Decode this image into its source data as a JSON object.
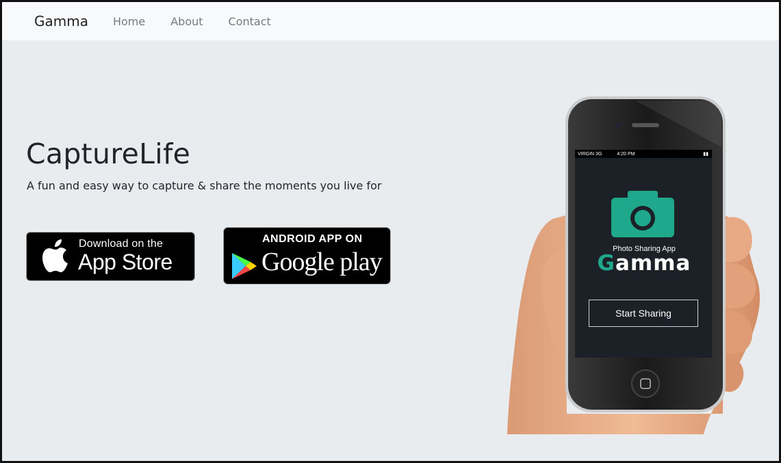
{
  "navbar": {
    "brand": "Gamma",
    "links": [
      "Home",
      "About",
      "Contact"
    ]
  },
  "hero": {
    "title": "CaptureLife",
    "subtitle": "A fun and easy way to capture & share the moments you live for"
  },
  "badges": {
    "appstore": {
      "small": "Download on the",
      "big": "App Store"
    },
    "googleplay": {
      "top": "ANDROID APP ON",
      "big": "Google play"
    }
  },
  "phone": {
    "status": {
      "carrier": "VIRGIN  3G",
      "time": "4:20 PM"
    },
    "tagline": "Photo Sharing App",
    "app_name_first": "G",
    "app_name_rest": "amma",
    "button": "Start Sharing"
  },
  "colors": {
    "accent": "#1fa88c",
    "page_bg": "#e9ecef",
    "navbar_bg": "#f8f9fa",
    "phone_screen": "#1c2127"
  },
  "icons": [
    "apple-icon",
    "google-play-icon",
    "camera-icon"
  ]
}
